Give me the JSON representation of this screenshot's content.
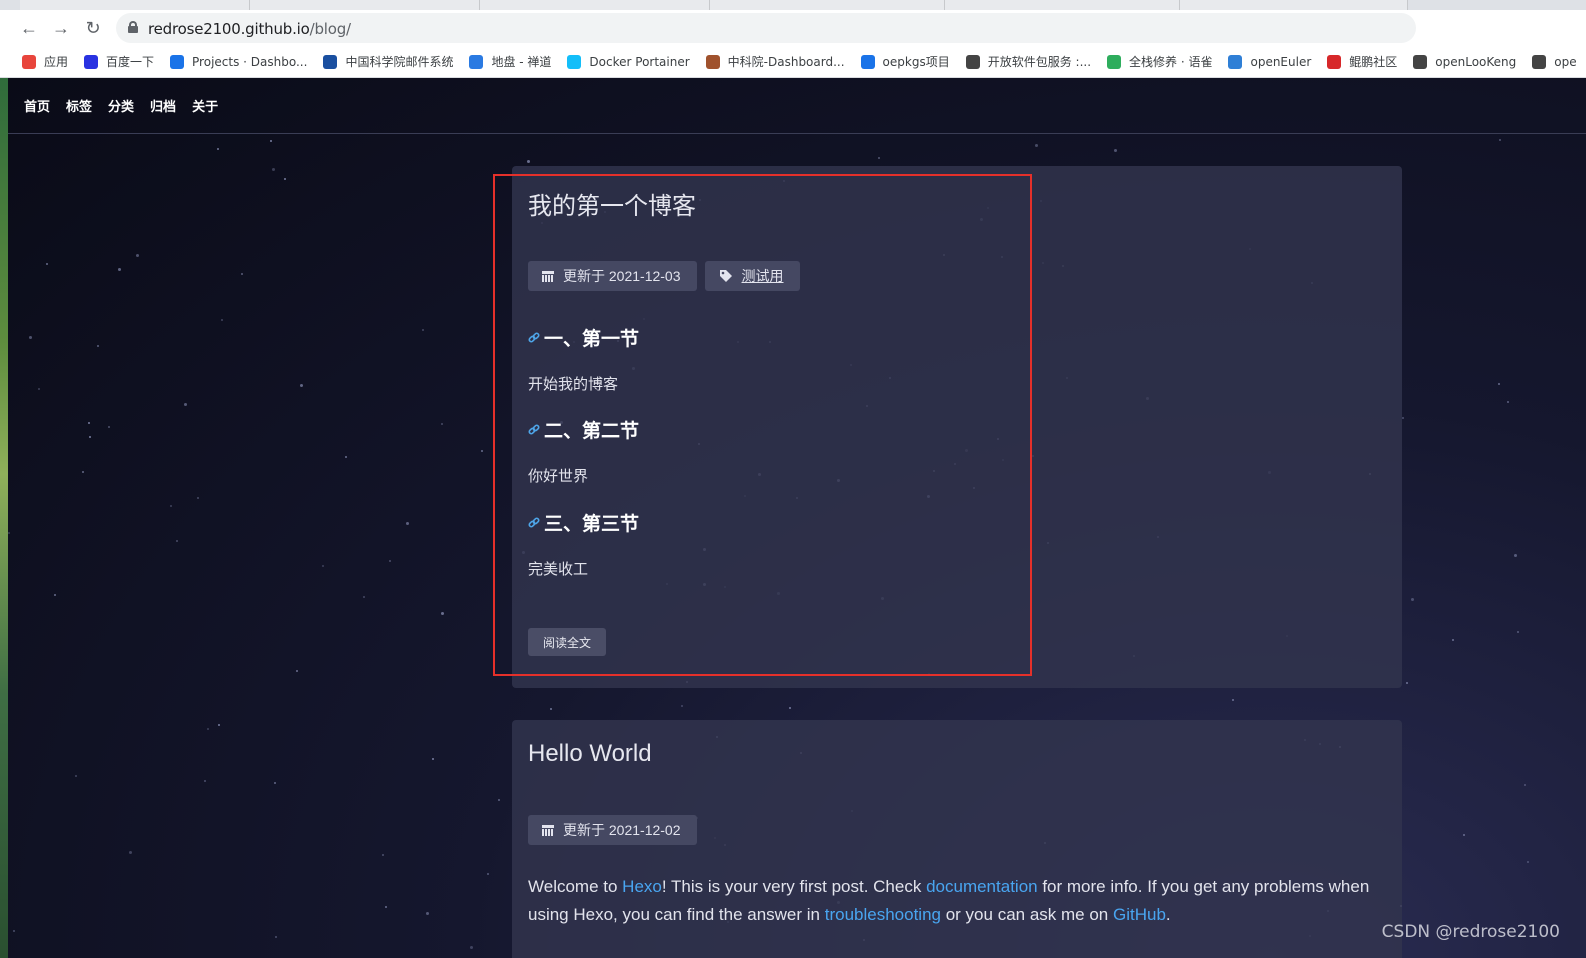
{
  "browser": {
    "url_host": "redrose2100.github.io",
    "url_path": "/blog/",
    "bookmarks": [
      {
        "label": "应用",
        "icon": "apps-grid-icon",
        "color": "#e8453c"
      },
      {
        "label": "百度一下",
        "icon": "baidu-paw-icon",
        "color": "#2932e1"
      },
      {
        "label": "Projects · Dashbo...",
        "icon": "link-icon",
        "color": "#1a73e8"
      },
      {
        "label": "中国科学院邮件系统",
        "icon": "mail-icon",
        "color": "#1a4fa0"
      },
      {
        "label": "地盘 - 禅道",
        "icon": "zentao-icon",
        "color": "#2a7ae2"
      },
      {
        "label": "Docker Portainer",
        "icon": "docker-icon",
        "color": "#13bef9"
      },
      {
        "label": "中科院-Dashboard...",
        "icon": "avatar-icon",
        "color": "#a0522d"
      },
      {
        "label": "oepkgs项目",
        "icon": "link-icon",
        "color": "#1a73e8"
      },
      {
        "label": "开放软件包服务 :...",
        "icon": "globe-icon",
        "color": "#444"
      },
      {
        "label": "全栈修养 · 语雀",
        "icon": "leaf-icon",
        "color": "#2ead5d"
      },
      {
        "label": "openEuler",
        "icon": "openeuler-icon",
        "color": "#2f7fd6"
      },
      {
        "label": "鲲鹏社区",
        "icon": "kunpeng-icon",
        "color": "#d7282a"
      },
      {
        "label": "openLooKeng",
        "icon": "globe-icon",
        "color": "#444"
      },
      {
        "label": "ope",
        "icon": "globe-icon",
        "color": "#444"
      }
    ]
  },
  "site": {
    "nav": [
      "首页",
      "标签",
      "分类",
      "归档",
      "关于"
    ]
  },
  "posts": [
    {
      "title": "我的第一个博客",
      "updated": "更新于 2021-12-03",
      "tag": "测试用",
      "sections": [
        {
          "heading": "一、第一节",
          "text": "开始我的博客"
        },
        {
          "heading": "二、第二节",
          "text": "你好世界"
        },
        {
          "heading": "三、第三节",
          "text": "完美收工"
        }
      ],
      "read_more": "阅读全文"
    },
    {
      "title": "Hello World",
      "updated": "更新于 2021-12-02",
      "body": {
        "t1": "Welcome to ",
        "l1": "Hexo",
        "t2": "! This is your very first post. Check ",
        "l2": "documentation",
        "t3": " for more info. If you get any problems when using Hexo, you can find the answer in ",
        "l3": "troubleshooting",
        "t4": " or you can ask me on ",
        "l4": "GitHub",
        "t5": "."
      }
    }
  ],
  "watermark": "CSDN @redrose2100"
}
